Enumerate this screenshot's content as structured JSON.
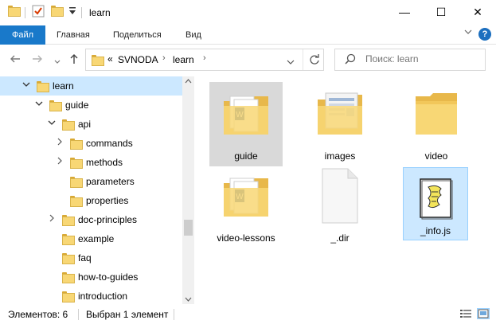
{
  "window": {
    "title": "learn",
    "minimize": "—",
    "maximize": "☐",
    "close": "✕"
  },
  "ribbon": {
    "tabs": [
      "Файл",
      "Главная",
      "Поделиться",
      "Вид"
    ],
    "help": "?"
  },
  "address": {
    "prefix": "«",
    "crumbs": [
      "SVNODA",
      "learn"
    ],
    "separator": "›"
  },
  "search": {
    "placeholder": "Поиск: learn"
  },
  "tree": [
    {
      "label": "learn",
      "level": 0,
      "expanded": true,
      "selected": true
    },
    {
      "label": "guide",
      "level": 1,
      "expanded": true
    },
    {
      "label": "api",
      "level": 2,
      "expanded": true
    },
    {
      "label": "commands",
      "level": 3,
      "expanded": false,
      "hasChildren": true
    },
    {
      "label": "methods",
      "level": 3,
      "expanded": false,
      "hasChildren": true
    },
    {
      "label": "parameters",
      "level": 3,
      "hasChildren": false
    },
    {
      "label": "properties",
      "level": 3,
      "hasChildren": false
    },
    {
      "label": "doc-principles",
      "level": 2,
      "expanded": false,
      "hasChildren": true
    },
    {
      "label": "example",
      "level": 2,
      "hasChildren": false
    },
    {
      "label": "faq",
      "level": 2,
      "hasChildren": false
    },
    {
      "label": "how-to-guides",
      "level": 2,
      "hasChildren": false
    },
    {
      "label": "introduction",
      "level": 2,
      "hasChildren": false
    }
  ],
  "items": [
    {
      "label": "guide",
      "type": "folder-docs",
      "highlighted": true
    },
    {
      "label": "images",
      "type": "folder-images"
    },
    {
      "label": "video",
      "type": "folder-empty"
    },
    {
      "label": "video-lessons",
      "type": "folder-docs"
    },
    {
      "label": "_.dir",
      "type": "file-blank"
    },
    {
      "label": "_info.js",
      "type": "file-script",
      "selected": true
    }
  ],
  "status": {
    "count": "Элементов: 6",
    "selection": "Выбран 1 элемент"
  },
  "colors": {
    "accent": "#1979ca",
    "selection": "#cce8ff",
    "folder": "#f8d775"
  }
}
